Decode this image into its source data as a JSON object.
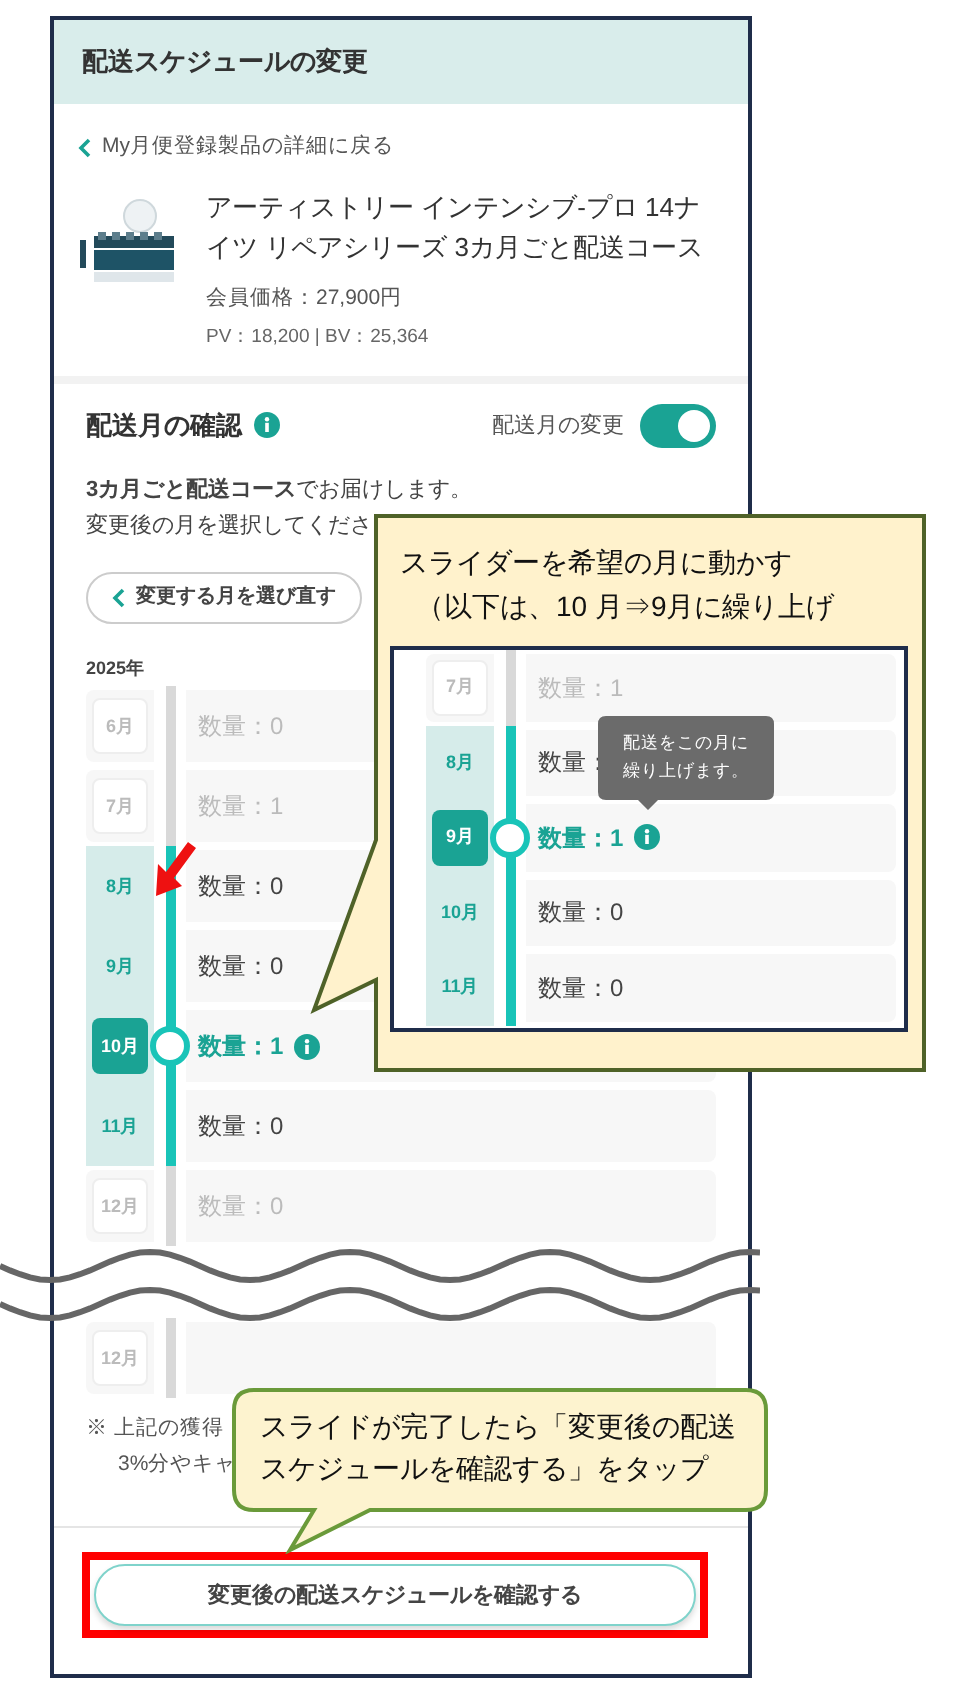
{
  "header": {
    "title": "配送スケジュールの変更"
  },
  "back_link": {
    "label": "My月便登録製品の詳細に戻る"
  },
  "product": {
    "kind": "picture",
    "title": "アーティストリー インテンシブ-プロ 14ナイツ リペアシリーズ 3カ月ごと配送コース",
    "price": "会員価格：27,900円",
    "points": "PV：18,200 | BV：25,364"
  },
  "delivery": {
    "title": "配送月の確認",
    "toggle": {
      "label": "配送月の変更",
      "on": true
    },
    "message": [
      "**3カ月ごと配送コース**でお届けします。",
      "変更後の月を選択してくださ"
    ],
    "reselect_button": "変更する月を選び直す",
    "year": "2025年",
    "months": [
      {
        "month": "6月",
        "quantity": "数量：0",
        "in_range": false,
        "selected": false
      },
      {
        "month": "7月",
        "quantity": "数量：1",
        "in_range": false,
        "selected": false
      },
      {
        "month": "8月",
        "quantity": "数量：0",
        "in_range": true,
        "selected": false
      },
      {
        "month": "9月",
        "quantity": "数量：0",
        "in_range": true,
        "selected": false
      },
      {
        "month": "10月",
        "quantity": "数量：1",
        "in_range": true,
        "selected": true
      },
      {
        "month": "11月",
        "quantity": "数量：0",
        "in_range": true,
        "selected": false
      },
      {
        "month": "12月",
        "quantity": "数量：0",
        "in_range": false,
        "selected": false
      }
    ],
    "after_break": [
      {
        "month": "12月"
      }
    ],
    "note": [
      "※ 上記の獲得",
      "3%分やキャ"
    ],
    "confirm_button": "変更後の配送スケジュールを確認する"
  },
  "slider_callout": {
    "lines": [
      "スライダーを希望の月に動かす",
      "（以下は、10 月⇒9月に繰り上げ"
    ],
    "example": {
      "months": [
        {
          "month": "7月",
          "quantity": "数量：1",
          "in_range": false,
          "selected": false
        },
        {
          "month": "8月",
          "quantity": "数量：",
          "in_range": true,
          "selected": false
        },
        {
          "month": "9月",
          "quantity": "数量：1",
          "in_range": true,
          "selected": true
        },
        {
          "month": "10月",
          "quantity": "数量：0",
          "in_range": true,
          "selected": false
        },
        {
          "month": "11月",
          "quantity": "数量：0",
          "in_range": true,
          "selected": false
        }
      ],
      "tooltip": [
        "配送をこの月に",
        "繰り上げます。"
      ]
    }
  },
  "tap_callout": {
    "lines": [
      "スライドが完了したら「変更後の配送",
      "スケジュールを確認する」をタップ"
    ]
  }
}
